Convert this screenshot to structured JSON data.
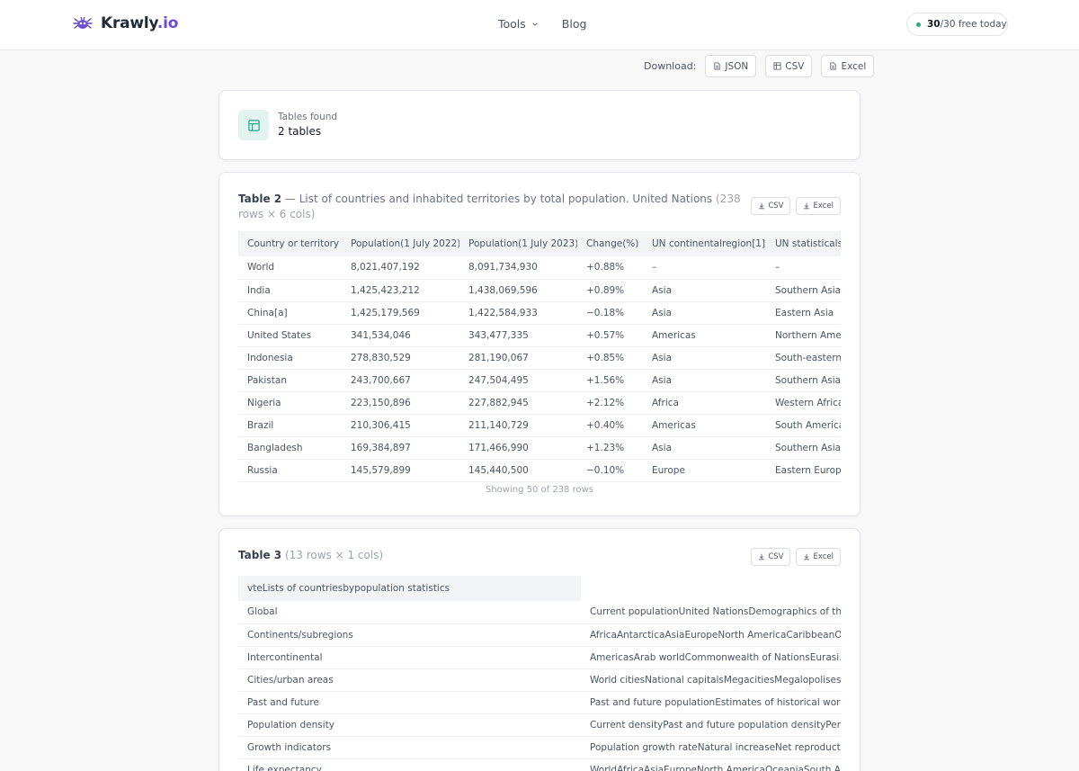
{
  "brand": {
    "name": "Krawly",
    "tld": ".io"
  },
  "nav": {
    "tools": "Tools",
    "blog": "Blog"
  },
  "credits": {
    "used": "30",
    "rest": "/30 free today"
  },
  "download": {
    "label": "Download:",
    "json": "JSON",
    "csv": "CSV",
    "excel": "Excel"
  },
  "summary": {
    "label": "Tables found",
    "value": "2 tables"
  },
  "table2": {
    "name": "Table 2",
    "caption": " — List of countries and inhabited territories by total population. United Nations",
    "meta": "(238 rows × 6 cols)",
    "csv": "CSV",
    "excel": "Excel",
    "columns": [
      "Country or territory",
      "Population(1 July 2022)",
      "Population(1 July 2023)",
      "Change(%)",
      "UN continentalregion[1]",
      "UN statisticalsu"
    ],
    "rows": [
      [
        "World",
        "8,021,407,192",
        "8,091,734,930",
        "+0.88%",
        "–",
        "–"
      ],
      [
        "India",
        "1,425,423,212",
        "1,438,069,596",
        "+0.89%",
        "Asia",
        "Southern Asia"
      ],
      [
        "China[a]",
        "1,425,179,569",
        "1,422,584,933",
        "−0.18%",
        "Asia",
        "Eastern Asia"
      ],
      [
        "United States",
        "341,534,046",
        "343,477,335",
        "+0.57%",
        "Americas",
        "Northern Amer"
      ],
      [
        "Indonesia",
        "278,830,529",
        "281,190,067",
        "+0.85%",
        "Asia",
        "South-eastern A"
      ],
      [
        "Pakistan",
        "243,700,667",
        "247,504,495",
        "+1.56%",
        "Asia",
        "Southern Asia"
      ],
      [
        "Nigeria",
        "223,150,896",
        "227,882,945",
        "+2.12%",
        "Africa",
        "Western Africa"
      ],
      [
        "Brazil",
        "210,306,415",
        "211,140,729",
        "+0.40%",
        "Americas",
        "South America"
      ],
      [
        "Bangladesh",
        "169,384,897",
        "171,466,990",
        "+1.23%",
        "Asia",
        "Southern Asia"
      ],
      [
        "Russia",
        "145,579,899",
        "145,440,500",
        "−0.10%",
        "Europe",
        "Eastern Europe"
      ]
    ],
    "showing": "Showing 50 of 238 rows"
  },
  "table3": {
    "name": "Table 3",
    "meta": "(13 rows × 1 cols)",
    "csv": "CSV",
    "excel": "Excel",
    "columns": [
      "vteLists of countriesbypopulation statistics",
      ""
    ],
    "rows": [
      [
        "Global",
        "Current populationUnited NationsDemographics of th..."
      ],
      [
        "Continents/subregions",
        "AfricaAntarcticaAsiaEuropeNorth AmericaCaribbeanO..."
      ],
      [
        "Intercontinental",
        "AmericasArab worldCommonwealth of NationsEurasi..."
      ],
      [
        "Cities/urban areas",
        "World citiesNational capitalsMegacitiesMegalopolises"
      ],
      [
        "Past and future",
        "Past and future populationEstimates of historical worl..."
      ],
      [
        "Population density",
        "Current densityPast and future population densityPer..."
      ],
      [
        "Growth indicators",
        "Population growth rateNatural increaseNet reproduct..."
      ],
      [
        "Life expectancy",
        "WorldAfricaAsiaEuropeNorth AmericaOceaniaSouth A..."
      ]
    ]
  }
}
